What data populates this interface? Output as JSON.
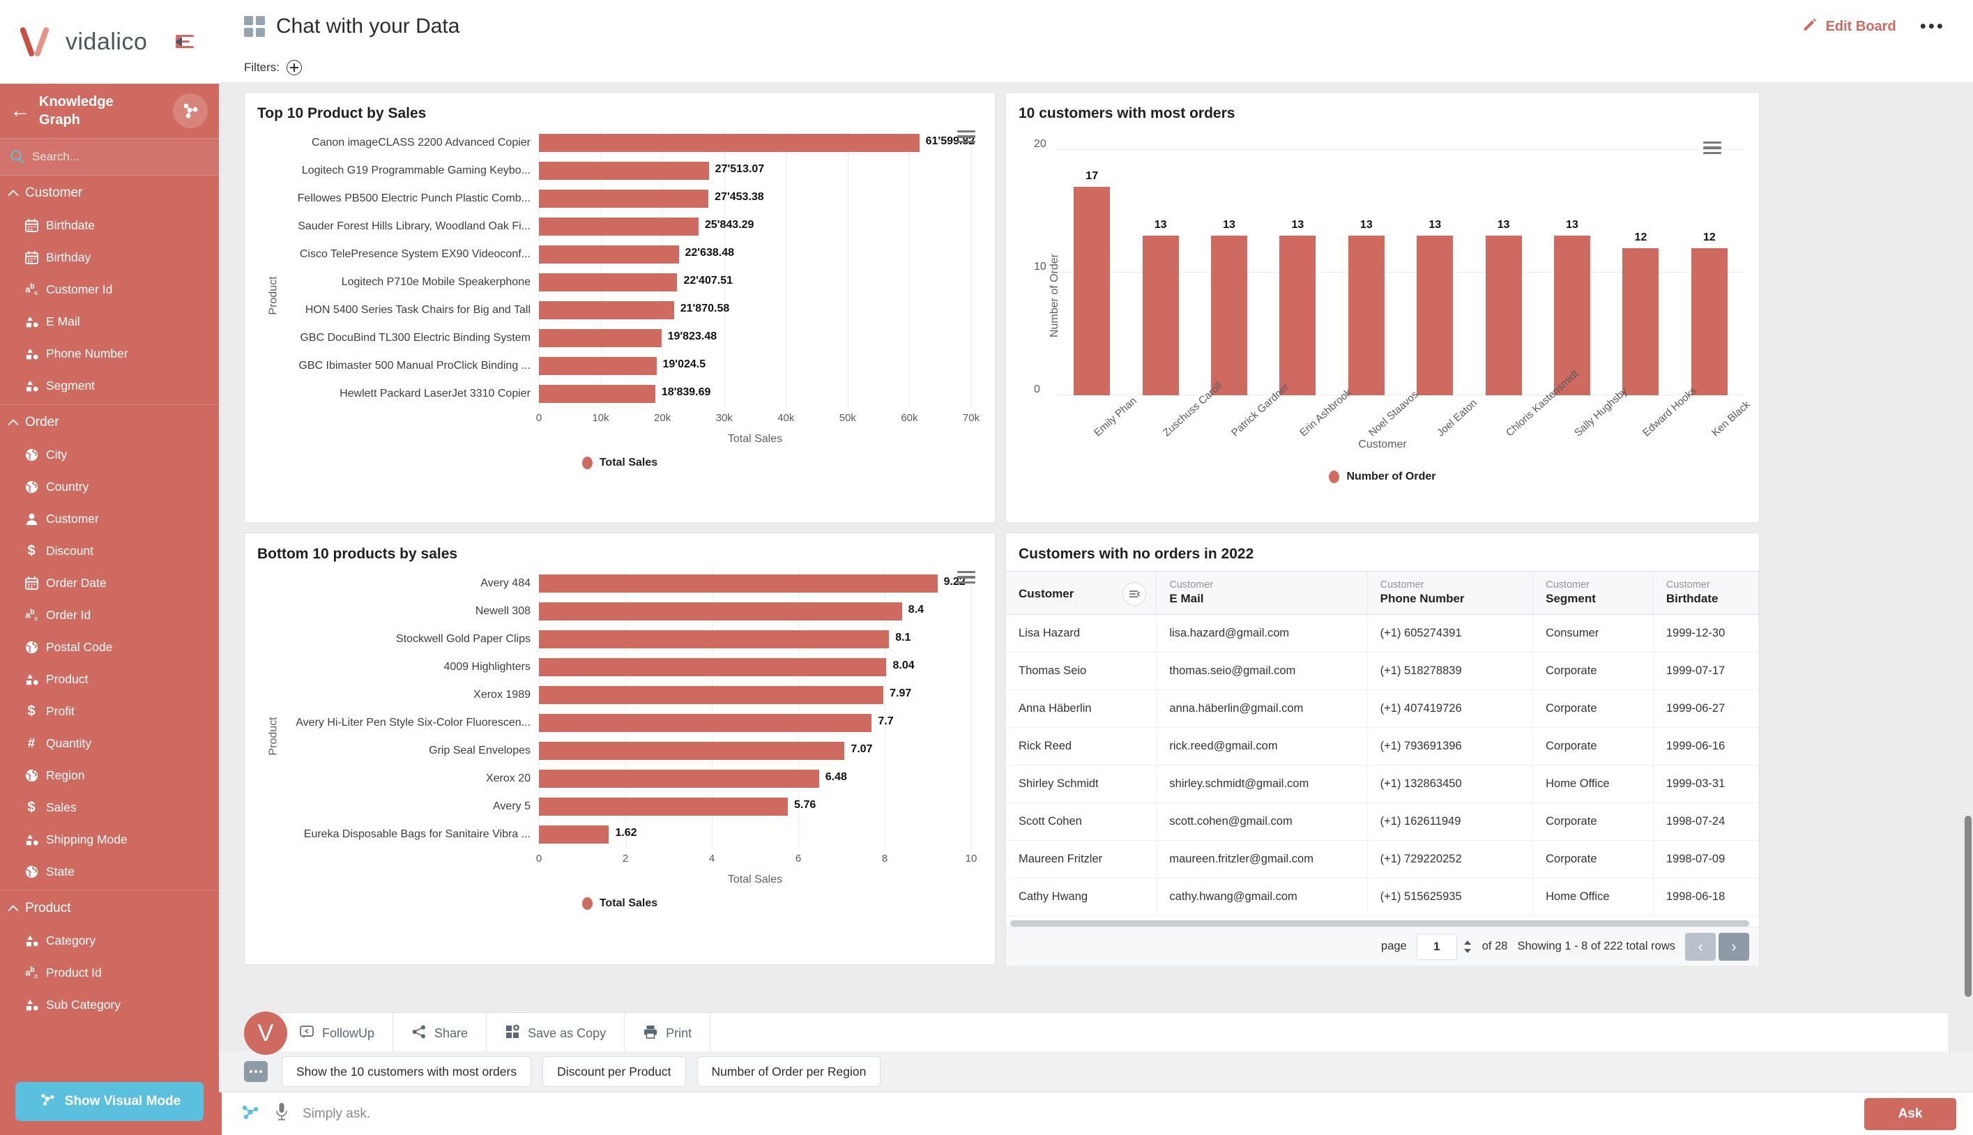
{
  "brand": {
    "name": "vidalico",
    "accent": "#cf6a60",
    "cyan": "#5bc0de"
  },
  "sidebar": {
    "kg_title": "Knowledge Graph",
    "search_placeholder": "Search...",
    "visual_mode_label": "Show Visual Mode",
    "groups": [
      {
        "label": "Customer",
        "items": [
          {
            "label": "Birthdate",
            "icon": "calendar-icon"
          },
          {
            "label": "Birthday",
            "icon": "calendar-icon"
          },
          {
            "label": "Customer Id",
            "icon": "abc-icon"
          },
          {
            "label": "E Mail",
            "icon": "shapes-icon"
          },
          {
            "label": "Phone Number",
            "icon": "shapes-icon"
          },
          {
            "label": "Segment",
            "icon": "shapes-icon"
          }
        ]
      },
      {
        "label": "Order",
        "items": [
          {
            "label": "City",
            "icon": "globe-icon"
          },
          {
            "label": "Country",
            "icon": "globe-icon"
          },
          {
            "label": "Customer",
            "icon": "person-icon"
          },
          {
            "label": "Discount",
            "icon": "dollar-icon"
          },
          {
            "label": "Order Date",
            "icon": "calendar-icon"
          },
          {
            "label": "Order Id",
            "icon": "abc-icon"
          },
          {
            "label": "Postal Code",
            "icon": "globe-icon"
          },
          {
            "label": "Product",
            "icon": "shapes-icon"
          },
          {
            "label": "Profit",
            "icon": "dollar-icon"
          },
          {
            "label": "Quantity",
            "icon": "hash-icon"
          },
          {
            "label": "Region",
            "icon": "globe-icon"
          },
          {
            "label": "Sales",
            "icon": "dollar-icon"
          },
          {
            "label": "Shipping Mode",
            "icon": "shapes-icon"
          },
          {
            "label": "State",
            "icon": "globe-icon"
          }
        ]
      },
      {
        "label": "Product",
        "items": [
          {
            "label": "Category",
            "icon": "shapes-icon"
          },
          {
            "label": "Product Id",
            "icon": "abc-icon"
          },
          {
            "label": "Sub Category",
            "icon": "shapes-icon"
          }
        ]
      }
    ]
  },
  "header": {
    "title": "Chat with your Data",
    "edit_board_label": "Edit Board",
    "filters_label": "Filters:"
  },
  "chart_data": [
    {
      "type": "bar",
      "orientation": "horizontal",
      "title": "Top 10 Product by Sales",
      "ylabel": "Product",
      "xlabel": "Total Sales",
      "legend": "Total Sales",
      "legend_position": "bottom",
      "grid": true,
      "xlim": [
        0,
        70000
      ],
      "xticks": [
        "0",
        "10k",
        "20k",
        "30k",
        "40k",
        "50k",
        "60k",
        "70k"
      ],
      "xtick_values": [
        0,
        10000,
        20000,
        30000,
        40000,
        50000,
        60000,
        70000
      ],
      "categories": [
        "Canon imageCLASS 2200 Advanced Copier",
        "Logitech G19 Programmable Gaming Keybo...",
        "Fellowes PB500 Electric Punch Plastic Comb...",
        "Sauder Forest Hills Library, Woodland Oak Fi...",
        "Cisco TelePresence System EX90 Videoconf...",
        "Logitech P710e Mobile Speakerphone",
        "HON 5400 Series Task Chairs for Big and Tall",
        "GBC DocuBind TL300 Electric Binding System",
        "GBC Ibimaster 500 Manual ProClick Binding ...",
        "Hewlett Packard LaserJet 3310 Copier"
      ],
      "values": [
        61599.82,
        27513.07,
        27453.38,
        25843.29,
        22638.48,
        22407.51,
        21870.58,
        19823.48,
        19024.5,
        18839.69
      ],
      "labels": [
        "61'599.82",
        "27'513.07",
        "27'453.38",
        "25'843.29",
        "22'638.48",
        "22'407.51",
        "21'870.58",
        "19'823.48",
        "19'024.5",
        "18'839.69"
      ]
    },
    {
      "type": "bar",
      "orientation": "vertical",
      "title": "10 customers with most orders",
      "ylabel": "Number of Order",
      "xlabel": "Customer",
      "legend": "Number of Order",
      "legend_position": "bottom",
      "grid": true,
      "ylim": [
        0,
        20
      ],
      "yticks": [
        "0",
        "10",
        "20"
      ],
      "ytick_values": [
        0,
        10,
        20
      ],
      "categories": [
        "Emily Phan",
        "Zuschuss Caroll",
        "Patrick Gardner",
        "Erin Ashbrook",
        "Noel Staavos",
        "Joel Eaton",
        "Chloris Kastensmidt",
        "Sally Hughsby",
        "Edward Hooks",
        "Ken Black"
      ],
      "values": [
        17,
        13,
        13,
        13,
        13,
        13,
        13,
        13,
        12,
        12
      ],
      "labels": [
        "17",
        "13",
        "13",
        "13",
        "13",
        "13",
        "13",
        "13",
        "12",
        "12"
      ]
    },
    {
      "type": "bar",
      "orientation": "horizontal",
      "title": "Bottom 10 products by sales",
      "ylabel": "Product",
      "xlabel": "Total Sales",
      "legend": "Total Sales",
      "legend_position": "bottom",
      "grid": true,
      "xlim": [
        0,
        10
      ],
      "xticks": [
        "0",
        "2",
        "4",
        "6",
        "8",
        "10"
      ],
      "xtick_values": [
        0,
        2,
        4,
        6,
        8,
        10
      ],
      "categories": [
        "Avery 484",
        "Newell 308",
        "Stockwell Gold Paper Clips",
        "4009 Highlighters",
        "Xerox 1989",
        "Avery Hi-Liter Pen Style Six-Color Fluorescen...",
        "Grip Seal Envelopes",
        "Xerox 20",
        "Avery 5",
        "Eureka Disposable Bags for Sanitaire Vibra ..."
      ],
      "values": [
        9.22,
        8.4,
        8.1,
        8.04,
        7.97,
        7.7,
        7.07,
        6.48,
        5.76,
        1.62
      ],
      "labels": [
        "9.22",
        "8.4",
        "8.1",
        "8.04",
        "7.97",
        "7.7",
        "7.07",
        "6.48",
        "5.76",
        "1.62"
      ]
    }
  ],
  "table_card": {
    "title": "Customers with no orders in 2022",
    "columns": [
      {
        "sup": "",
        "main": "Customer"
      },
      {
        "sup": "Customer",
        "main": "E Mail"
      },
      {
        "sup": "Customer",
        "main": "Phone Number"
      },
      {
        "sup": "Customer",
        "main": "Segment"
      },
      {
        "sup": "Customer",
        "main": "Birthdate"
      }
    ],
    "rows": [
      [
        "Lisa Hazard",
        "lisa.hazard@gmail.com",
        "(+1) 605274391",
        "Consumer",
        "1999-12-30"
      ],
      [
        "Thomas Seio",
        "thomas.seio@gmail.com",
        "(+1) 518278839",
        "Corporate",
        "1999-07-17"
      ],
      [
        "Anna Häberlin",
        "anna.häberlin@gmail.com",
        "(+1) 407419726",
        "Corporate",
        "1999-06-27"
      ],
      [
        "Rick Reed",
        "rick.reed@gmail.com",
        "(+1) 793691396",
        "Corporate",
        "1999-06-16"
      ],
      [
        "Shirley Schmidt",
        "shirley.schmidt@gmail.com",
        "(+1) 132863450",
        "Home Office",
        "1999-03-31"
      ],
      [
        "Scott Cohen",
        "scott.cohen@gmail.com",
        "(+1) 162611949",
        "Corporate",
        "1998-07-24"
      ],
      [
        "Maureen Fritzler",
        "maureen.fritzler@gmail.com",
        "(+1) 729220252",
        "Corporate",
        "1998-07-09"
      ],
      [
        "Cathy Hwang",
        "cathy.hwang@gmail.com",
        "(+1) 515625935",
        "Home Office",
        "1998-06-18"
      ]
    ],
    "pager": {
      "page_label": "page",
      "page_value": "1",
      "of_label": "of 28",
      "showing": "Showing 1 - 8 of 222 total rows"
    }
  },
  "actions": [
    {
      "label": "FollowUp",
      "icon": "followup-icon"
    },
    {
      "label": "Share",
      "icon": "share-icon"
    },
    {
      "label": "Save as Copy",
      "icon": "copy-icon"
    },
    {
      "label": "Print",
      "icon": "print-icon"
    }
  ],
  "suggestions": [
    "Show the 10 customers with most orders",
    "Discount per Product",
    "Number of Order per Region"
  ],
  "ask": {
    "placeholder": "Simply ask.",
    "button_label": "Ask"
  }
}
